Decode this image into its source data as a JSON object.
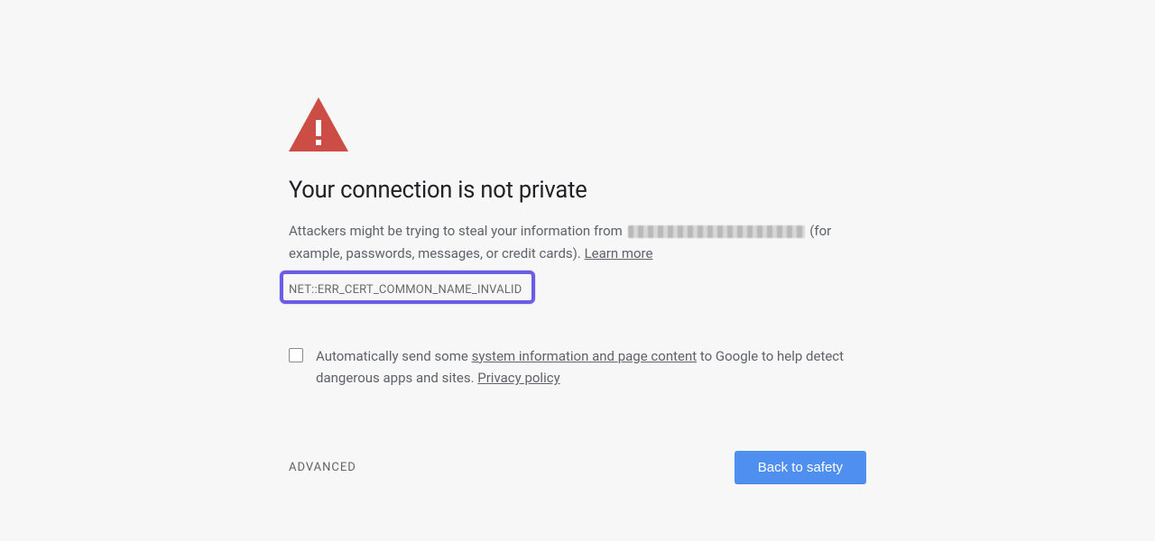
{
  "heading": "Your connection is not private",
  "descPrefix": "Attackers might be trying to steal your information from ",
  "descSuffixStart": " (for example, passwords, messages, or credit cards). ",
  "learnMore": "Learn more",
  "errorCode": "NET::ERR_CERT_COMMON_NAME_INVALID",
  "optIn": {
    "before": "Automatically send some ",
    "link": "system information and page content",
    "after": " to Google to help detect dangerous apps and sites. ",
    "privacy": "Privacy policy"
  },
  "advanced": "ADVANCED",
  "backToSafety": "Back to safety"
}
